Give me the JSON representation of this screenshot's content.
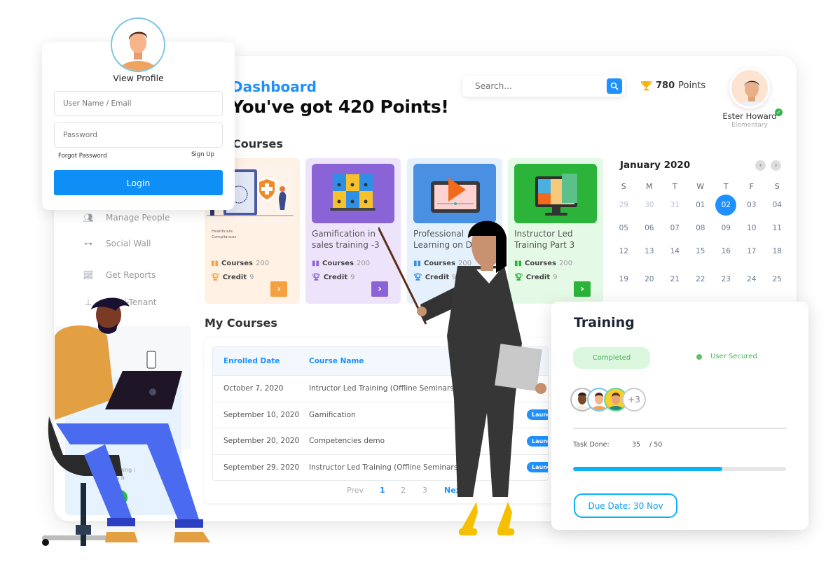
{
  "header": {
    "title": "Dashboard",
    "headline": "You've got 420 Points!",
    "search_placeholder": "Search...",
    "points_value": "780",
    "points_label": "Points",
    "user_name": "Ester Howard",
    "user_level": "Elementary"
  },
  "sections": {
    "courses": "Courses",
    "my_courses": "My Courses"
  },
  "courses": [
    {
      "name": "Healthcare Compliances",
      "thumb_caption": "Healthcare Compliances",
      "courses_label": "Courses",
      "courses_count": "200",
      "credit_label": "Credit",
      "credit": "9",
      "accent": "#f5a142",
      "bg": "#fff1e4"
    },
    {
      "name": "Gamification in sales training -3",
      "line1": "Gamification in",
      "line2": "sales training -3",
      "courses_label": "Courses",
      "courses_count": "200",
      "credit_label": "Credit",
      "credit": "9",
      "accent": "#8a64d6",
      "bg": "#ede4fb"
    },
    {
      "name": "Professional Learning on Devices",
      "line1": "Professional",
      "line2": "Learning on Devic",
      "courses_label": "Courses",
      "courses_count": "200",
      "credit_label": "Credit",
      "credit": "9",
      "accent": "#3b8de0",
      "bg": "#e4f1fd"
    },
    {
      "name": "Instructor Led Training Part 3",
      "line1": "Instructor Led",
      "line2": "Training Part 3",
      "courses_label": "Courses",
      "courses_count": "200",
      "credit_label": "Credit",
      "credit": "9",
      "accent": "#2bb33a",
      "bg": "#e5fae6"
    }
  ],
  "calendar": {
    "title": "January 2020",
    "weekdays": [
      "S",
      "M",
      "T",
      "W",
      "T",
      "F",
      "S"
    ],
    "weeks": [
      [
        "29",
        "30",
        "31",
        "01",
        "02",
        "03",
        "04"
      ],
      [
        "05",
        "06",
        "07",
        "08",
        "09",
        "10",
        "11"
      ],
      [
        "12",
        "13",
        "14",
        "15",
        "16",
        "17",
        "18"
      ],
      [
        "19",
        "20",
        "21",
        "22",
        "23",
        "24",
        "25"
      ]
    ],
    "selected": "02",
    "prev_icon": "‹",
    "next_icon": "›"
  },
  "sidebar": {
    "items": [
      {
        "label": "Manage People",
        "icon": "people-icon"
      },
      {
        "label": "Social Wall",
        "icon": "network-icon"
      },
      {
        "label": "Get Reports",
        "icon": "chart-icon"
      },
      {
        "label": "Multi-Tenant",
        "icon": "hierarchy-icon"
      }
    ],
    "promo_line1": "everything i",
    "promo_line2": "phone fr"
  },
  "table": {
    "headers": [
      "Enrolled Date",
      "Course Name"
    ],
    "rows": [
      {
        "date": "October 7, 2020",
        "course": "Intructor Led Training (Offline Seminars & T",
        "action": ""
      },
      {
        "date": "September 10, 2020",
        "course": "Gamification",
        "action": "Launch"
      },
      {
        "date": "September 20, 2020",
        "course": "Competencies demo",
        "action": "Launch"
      },
      {
        "date": "September 29, 2020",
        "course": "Instructor Led Training (Offline Seminars)",
        "action": "Launch"
      }
    ],
    "pagination": {
      "prev": "Prev",
      "pages": [
        "1",
        "2",
        "3"
      ],
      "current": "1",
      "next": "Next"
    }
  },
  "login": {
    "title": "View Profile",
    "username_placeholder": "User Name / Email",
    "password_placeholder": "Password",
    "forgot": "Forgot Password",
    "signup": "Sign Up",
    "button": "Login"
  },
  "training": {
    "title": "Training",
    "status": "Completed",
    "security": "User Secured",
    "extra_members": "+3",
    "task_label": "Task Done:",
    "task_done": "35",
    "task_total": "/ 50",
    "progress_fraction": 0.7,
    "due": "Due Date: 30 Nov"
  },
  "colors": {
    "primary": "#1e90ff",
    "success": "#4bb55a",
    "progress": "#0db2f5"
  }
}
